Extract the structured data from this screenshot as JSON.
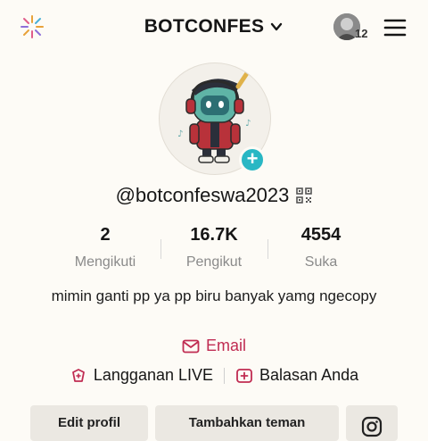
{
  "header": {
    "title": "BOTCONFES",
    "notif_count": "12",
    "icons": [
      "sparkle-icon",
      "chevron-down-icon",
      "menu-icon"
    ]
  },
  "profile": {
    "username": "@botconfeswa2023",
    "add_symbol": "+"
  },
  "stats": [
    {
      "value": "2",
      "label": "Mengikuti"
    },
    {
      "value": "16.7K",
      "label": "Pengikut"
    },
    {
      "value": "4554",
      "label": "Suka"
    }
  ],
  "bio": {
    "text": "mimin ganti pp ya pp biru banyak yamg ngecopy",
    "email": "Email"
  },
  "links": {
    "live": "Langganan LIVE",
    "replies": "Balasan Anda"
  },
  "buttons": {
    "edit": "Edit profil",
    "add_friends": "Tambahkan teman"
  },
  "colors": {
    "accent": "#c02c52",
    "add_button": "#29b7c4",
    "background": "#fdfbf6"
  }
}
